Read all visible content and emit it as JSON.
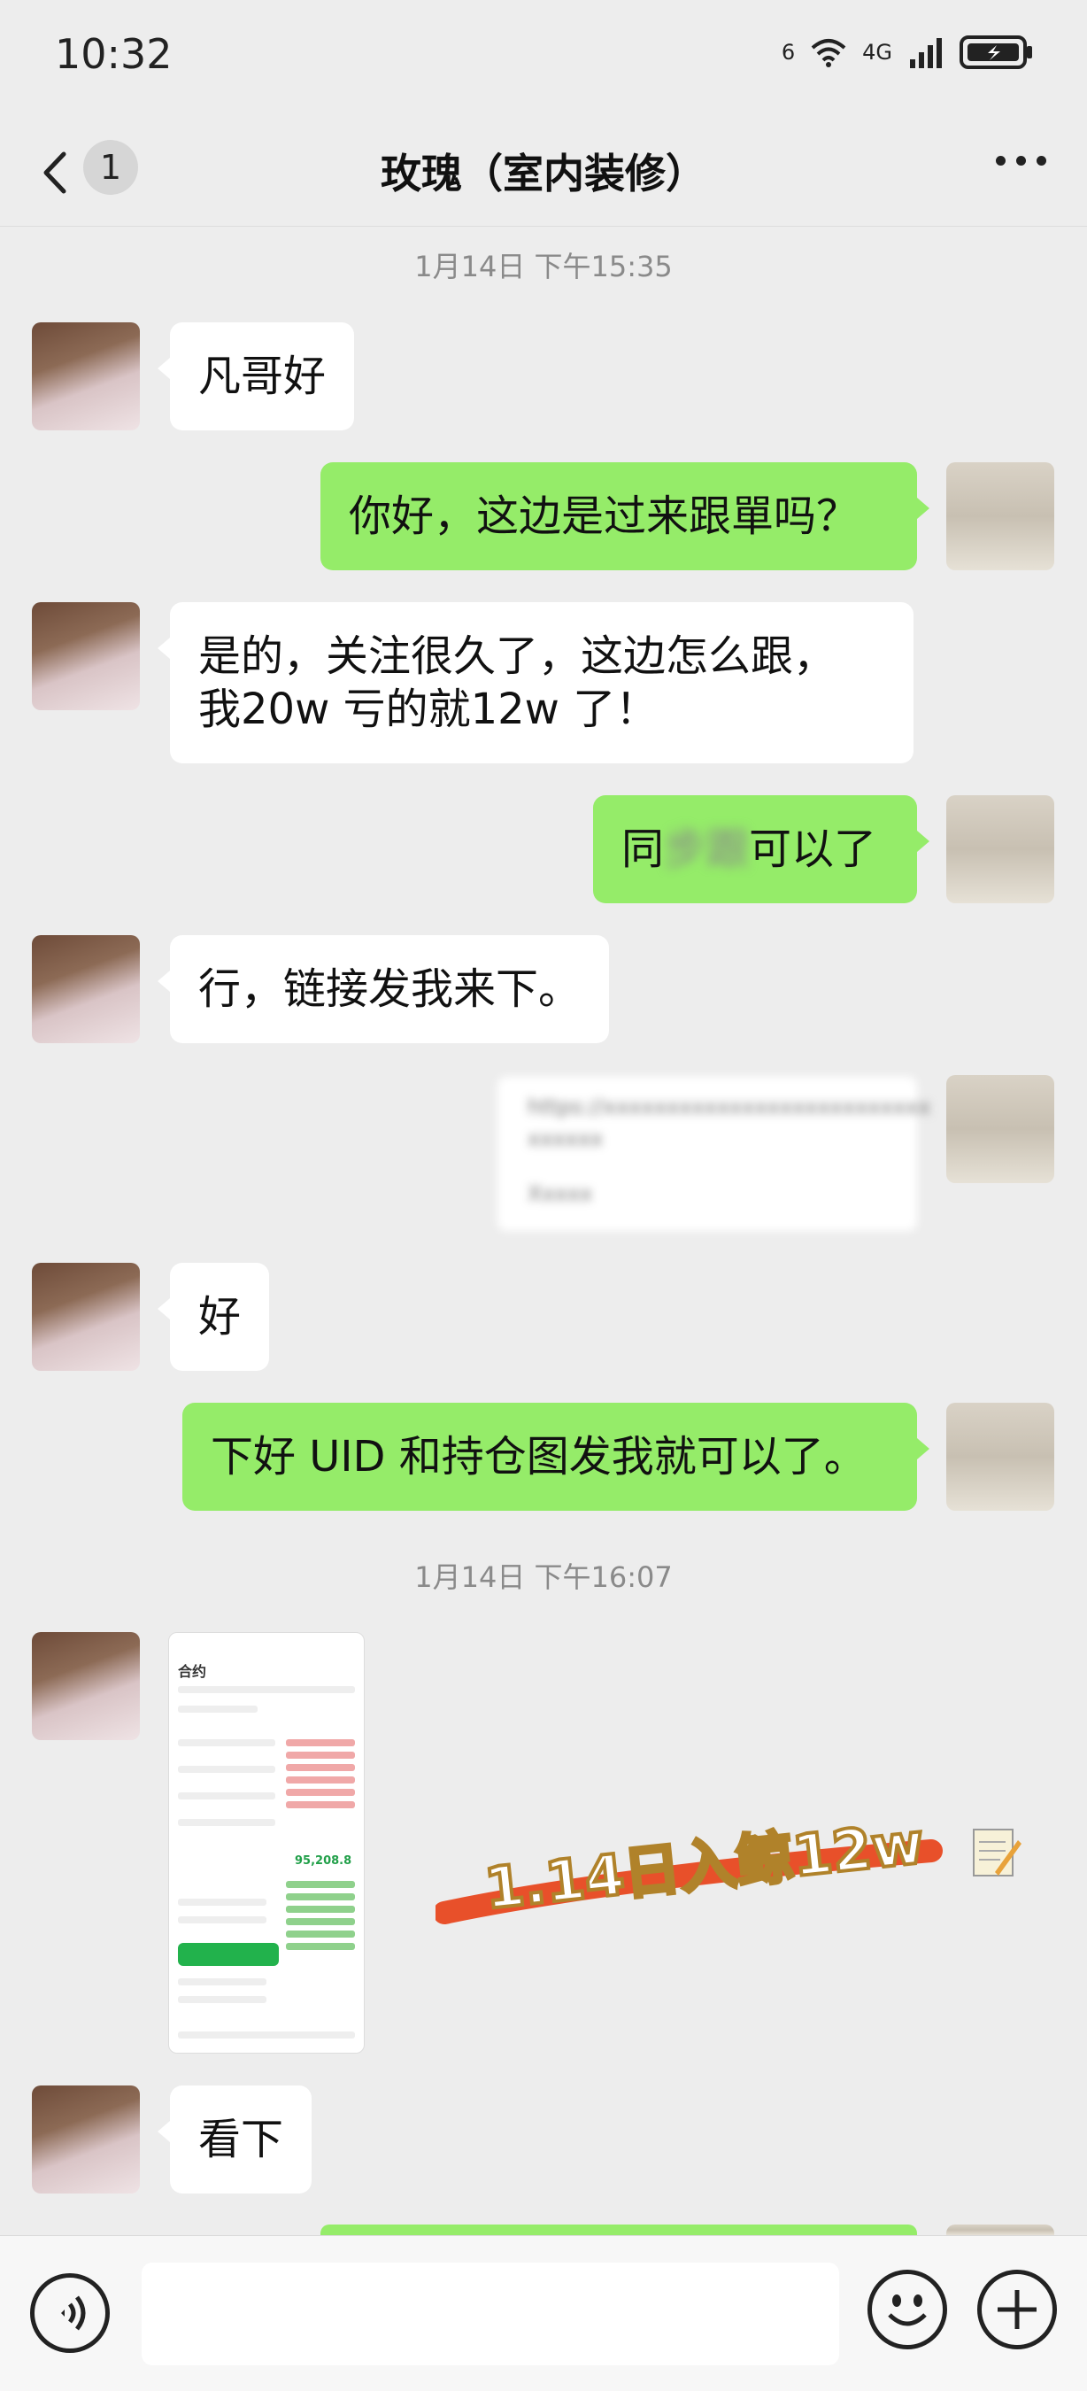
{
  "status": {
    "time": "10:32",
    "sim_label": "6",
    "net_label": "4G"
  },
  "header": {
    "title": "玫瑰（室内装修）",
    "unread": "1"
  },
  "timestamps": [
    "1月14日 下午15:35",
    "1月14日 下午16:07"
  ],
  "messages": [
    {
      "side": "left",
      "text": "凡哥好"
    },
    {
      "side": "right",
      "text": "你好，这边是过来跟單吗？"
    },
    {
      "side": "left",
      "line1": "是的，关注很久了，这边怎么跟，",
      "line2": "我20w 亏的就12w 了！"
    },
    {
      "side": "right",
      "prefix": "同",
      "blurred": "步跟",
      "suffix": "可以了"
    },
    {
      "side": "left",
      "text": "行，链接发我来下。"
    },
    {
      "side": "right",
      "card_line1": "https://xxxxxxxxxxxxxxxxxxxxxxxxxx",
      "card_line2": "xxxxxx",
      "card_line3": "Xxxxx"
    },
    {
      "side": "left",
      "text": "好"
    },
    {
      "side": "right",
      "text": "下好 UID 和持仓图发我就可以了。"
    },
    {
      "side": "left",
      "image": "trading-screenshot"
    },
    {
      "side": "left",
      "text": "看下"
    }
  ],
  "screenshot": {
    "tab": "合约",
    "price": "95,208.8"
  },
  "annotation": "1.14日入鲸12w",
  "icons": {
    "back": "chevron-left-icon",
    "more": "more-dots-icon",
    "voice": "voice-icon",
    "emoji": "emoji-icon",
    "plus": "plus-icon"
  }
}
